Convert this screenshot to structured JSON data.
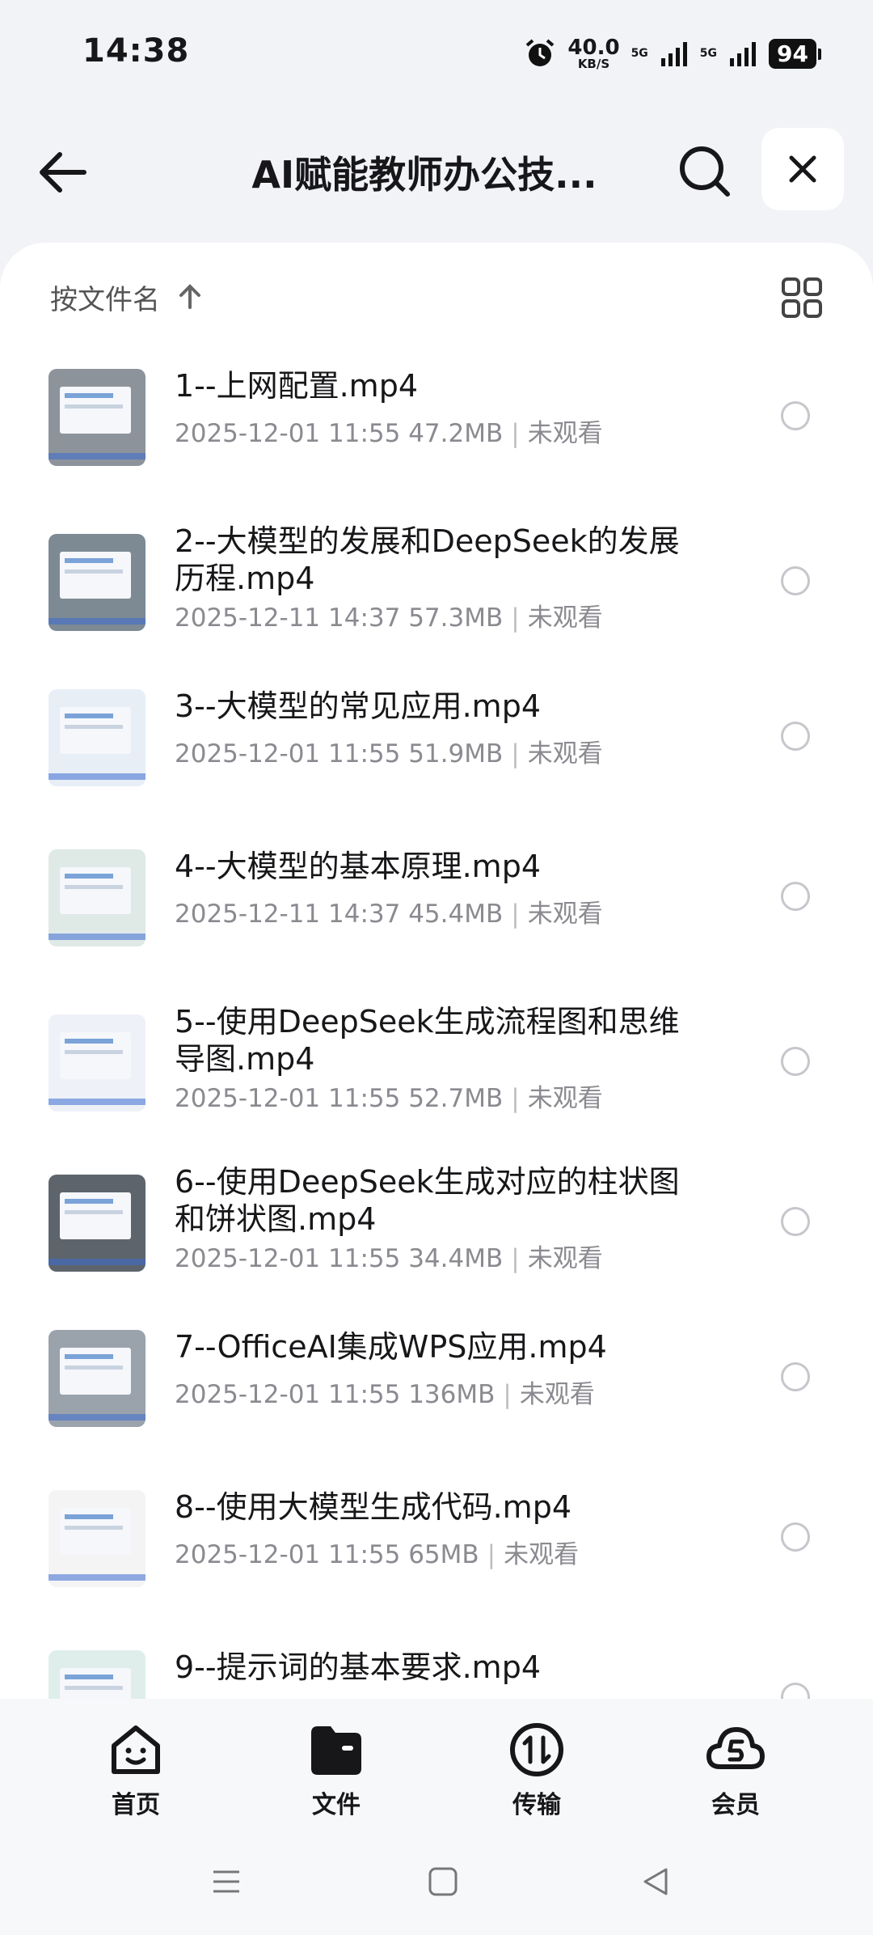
{
  "status": {
    "time": "14:38",
    "speed": "40.0",
    "speed_unit": "KB/S",
    "net1": "5G",
    "net2": "5G",
    "battery": "94"
  },
  "header": {
    "title": "AI赋能教师办公技..."
  },
  "sort": {
    "label": "按文件名"
  },
  "files": [
    {
      "name": "1--上网配置.mp4",
      "date": "2025-12-01 11:55",
      "size": "47.2MB",
      "status": "未观看"
    },
    {
      "name": "2--大模型的发展和DeepSeek的发展历程.mp4",
      "date": "2025-12-11 14:37",
      "size": "57.3MB",
      "status": "未观看"
    },
    {
      "name": "3--大模型的常见应用.mp4",
      "date": "2025-12-01 11:55",
      "size": "51.9MB",
      "status": "未观看"
    },
    {
      "name": "4--大模型的基本原理.mp4",
      "date": "2025-12-11 14:37",
      "size": "45.4MB",
      "status": "未观看"
    },
    {
      "name": "5--使用DeepSeek生成流程图和思维导图.mp4",
      "date": "2025-12-01 11:55",
      "size": "52.7MB",
      "status": "未观看"
    },
    {
      "name": "6--使用DeepSeek生成对应的柱状图和饼状图.mp4",
      "date": "2025-12-01 11:55",
      "size": "34.4MB",
      "status": "未观看"
    },
    {
      "name": "7--OfficeAI集成WPS应用.mp4",
      "date": "2025-12-01 11:55",
      "size": "136MB",
      "status": "未观看"
    },
    {
      "name": "8--使用大模型生成代码.mp4",
      "date": "2025-12-01 11:55",
      "size": "65MB",
      "status": "未观看"
    },
    {
      "name": "9--提示词的基本要求.mp4",
      "date": "",
      "size": "",
      "status": ""
    }
  ],
  "nav": {
    "home": "首页",
    "files": "文件",
    "transfer": "传输",
    "vip": "会员"
  }
}
